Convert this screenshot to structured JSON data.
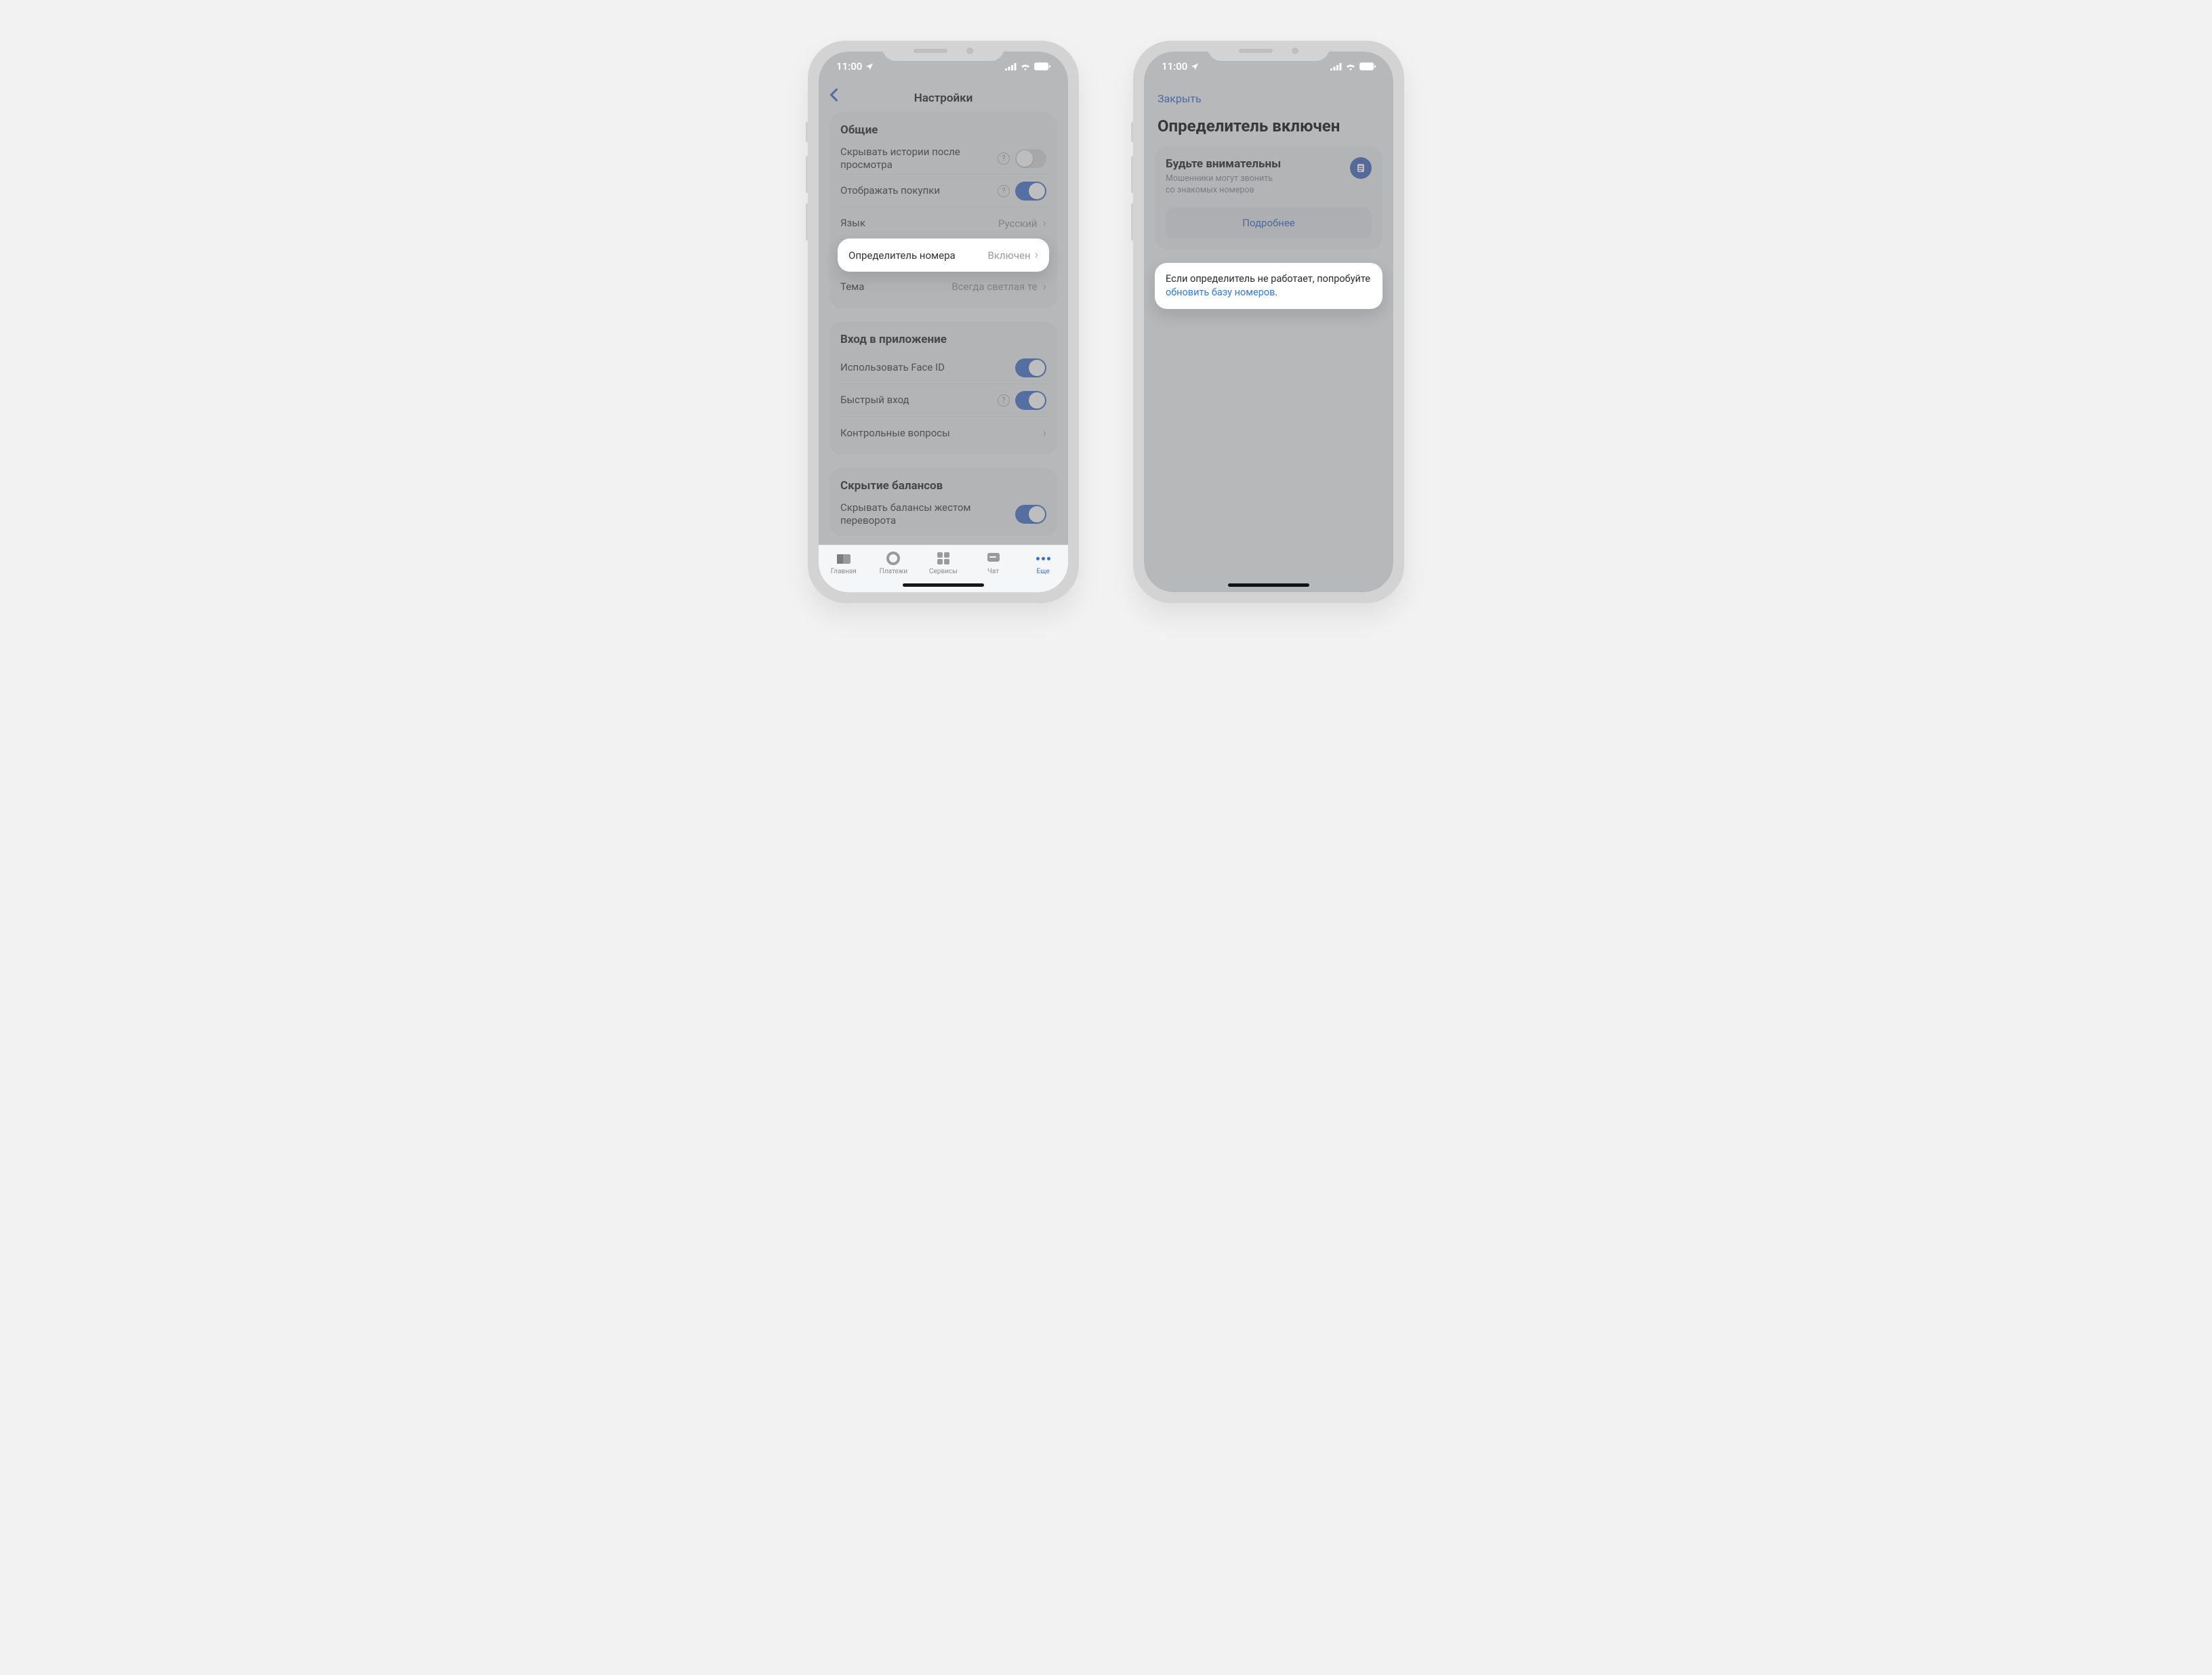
{
  "status": {
    "time": "11:00"
  },
  "phone1": {
    "header_title": "Настройки",
    "section1": {
      "title": "Общие",
      "rows": [
        {
          "label": "Скрывать истории после просмотра",
          "has_q": true,
          "toggle": "off"
        },
        {
          "label": "Отображать покупки",
          "has_q": true,
          "toggle": "on"
        },
        {
          "label": "Язык",
          "value": "Русский",
          "chevron": true
        },
        {
          "label": "Определитель номера",
          "value": "Включен",
          "chevron": true,
          "highlight": true
        },
        {
          "label": "Тема",
          "value": "Всегда светлая те",
          "chevron": true
        }
      ]
    },
    "section2": {
      "title": "Вход в приложение",
      "rows": [
        {
          "label": "Использовать Face ID",
          "toggle": "on"
        },
        {
          "label": "Быстрый вход",
          "has_q": true,
          "toggle": "on"
        },
        {
          "label": "Контрольные вопросы",
          "chevron": true
        }
      ]
    },
    "section3": {
      "title": "Скрытие балансов",
      "rows": [
        {
          "label": "Скрывать балансы жестом переворота",
          "toggle": "on"
        }
      ]
    },
    "tabs": [
      {
        "label": "Главная"
      },
      {
        "label": "Платежи"
      },
      {
        "label": "Сервисы"
      },
      {
        "label": "Чат"
      },
      {
        "label": "Еще",
        "active": true
      }
    ]
  },
  "phone2": {
    "close_label": "Закрыть",
    "title": "Определитель включен",
    "card": {
      "title": "Будьте внимательны",
      "subtitle": "Мошенники могут звонить\nсо знакомых номеров",
      "button": "Подробнее"
    },
    "tip": {
      "text_before": "Если определитель не работает, попробуйте ",
      "link": "обновить базу номеров",
      "text_after": "."
    }
  }
}
